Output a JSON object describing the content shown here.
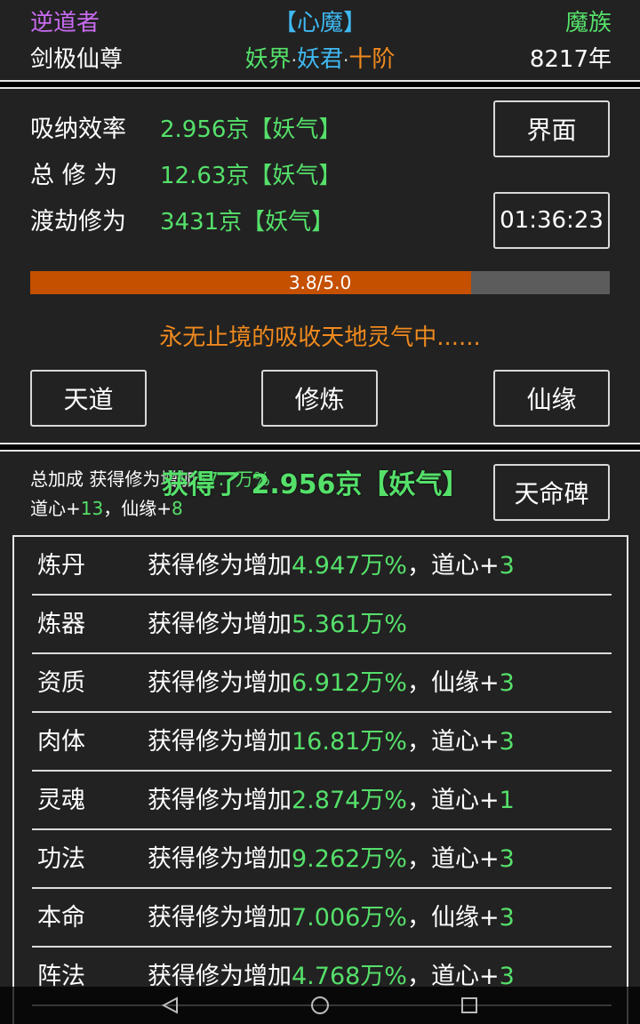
{
  "header": {
    "player_name": "逆道者",
    "state": "【心魔】",
    "faction": "魔族",
    "title": "剑极仙尊",
    "realm_world": "妖界",
    "realm_sep1": "·",
    "realm_rank": "妖君",
    "realm_sep2": "·",
    "realm_level": "十阶",
    "age": "8217年"
  },
  "stats": {
    "absorb_label": "吸纳效率",
    "absorb_value": "2.956京【妖气】",
    "total_label": "总 修 为",
    "total_value": "12.63京【妖气】",
    "tribulation_label": "渡劫修为",
    "tribulation_value": "3431京【妖气】",
    "interface_button": "界面",
    "timer": "01:36:23",
    "progress_text": "3.8/5.0",
    "progress_fraction": 0.76,
    "status_message": "永无止境的吸收天地灵气中......"
  },
  "actions": {
    "tiandao": "天道",
    "xiulian": "修炼",
    "xianyuan": "仙缘"
  },
  "bonus": {
    "total_prefix": "总加成 获得修为增加",
    "total_value": "57.7万%",
    "daoxin_label": "道心+",
    "daoxin_value": "13",
    "sep": "，",
    "xianyuan_label": "仙缘+",
    "xianyuan_value": "8",
    "gain_message": "获得了 2.956京【妖气】",
    "tianmingbei_button": "天命碑"
  },
  "list": [
    {
      "name": "炼丹",
      "prefix": "获得修为增加",
      "value": "4.947万%",
      "extra_label": "，道心+",
      "extra_value": "3"
    },
    {
      "name": "炼器",
      "prefix": "获得修为增加",
      "value": "5.361万%",
      "extra_label": "",
      "extra_value": ""
    },
    {
      "name": "资质",
      "prefix": "获得修为增加",
      "value": "6.912万%",
      "extra_label": "，仙缘+",
      "extra_value": "3"
    },
    {
      "name": "肉体",
      "prefix": "获得修为增加",
      "value": "16.81万%",
      "extra_label": "，道心+",
      "extra_value": "3"
    },
    {
      "name": "灵魂",
      "prefix": "获得修为增加",
      "value": "2.874万%",
      "extra_label": "，道心+",
      "extra_value": "1"
    },
    {
      "name": "功法",
      "prefix": "获得修为增加",
      "value": "9.262万%",
      "extra_label": "，道心+",
      "extra_value": "3"
    },
    {
      "name": "本命",
      "prefix": "获得修为增加",
      "value": "7.006万%",
      "extra_label": "，仙缘+",
      "extra_value": "3"
    },
    {
      "name": "阵法",
      "prefix": "获得修为增加",
      "value": "4.768万%",
      "extra_label": "，道心+",
      "extra_value": "3"
    }
  ],
  "colors": {
    "purple": "#c86bf0",
    "blue": "#3fb8f0",
    "green": "#55e06a",
    "orange": "#f08a1e",
    "progress_fill": "#c45000"
  }
}
